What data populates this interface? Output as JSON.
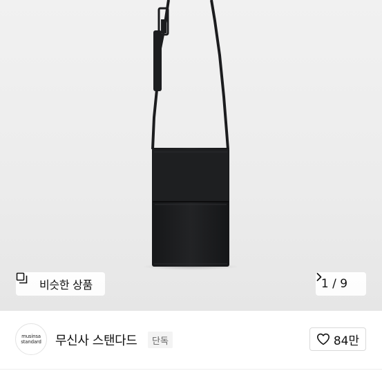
{
  "product_image": {
    "subject_icon": "crossbody-phone-bag"
  },
  "similar_products": {
    "label": "비슷한 상품",
    "icon": "stacked-squares-icon"
  },
  "pager": {
    "label": "1 / 9",
    "icon": "chevron-right-icon"
  },
  "brand": {
    "logo_line1": "musinsa",
    "logo_line2": "standard",
    "name": "무신사 스탠다드",
    "badge": "단독"
  },
  "like": {
    "count_label": "84만",
    "icon": "heart-outline-icon"
  },
  "colors": {
    "bag": "#1b1c1e",
    "background": "#ececec",
    "badge_bg": "#f3f3f3"
  }
}
